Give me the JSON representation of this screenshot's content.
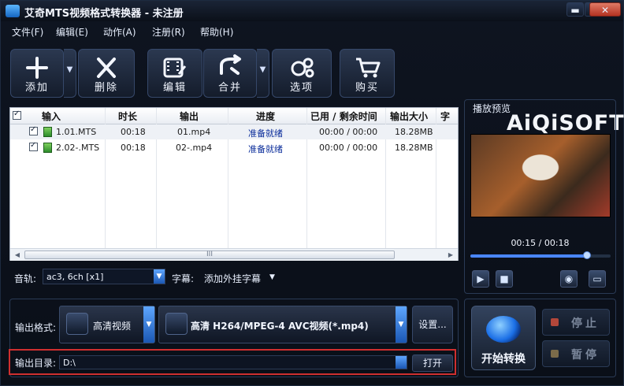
{
  "window": {
    "title": "艾奇MTS视频格式转换器 - 未注册",
    "min": "▬",
    "max": "▢",
    "close": "✕"
  },
  "menu": [
    {
      "label": "文件(F)"
    },
    {
      "label": "编辑(E)"
    },
    {
      "label": "动作(A)"
    },
    {
      "label": "注册(R)"
    },
    {
      "label": "帮助(H)"
    }
  ],
  "toolbar": {
    "add": "添加",
    "delete": "删除",
    "edit": "编辑",
    "merge": "合并",
    "options": "选项",
    "buy": "购买",
    "dropdown": "▼"
  },
  "brand": {
    "logo_text": "AiQiSOFT"
  },
  "table": {
    "headers": [
      "输入",
      "时长",
      "输出",
      "进度",
      "已用 / 剩余时间",
      "输出大小",
      "字幕"
    ],
    "rows": [
      {
        "input": "1.01.MTS",
        "duration": "00:18",
        "output": "01.mp4",
        "progress": "准备就绪",
        "time": "00:00 / 00:00",
        "size": "18.28MB"
      },
      {
        "input": "2.02-.MTS",
        "duration": "00:18",
        "output": "02-.mp4",
        "progress": "准备就绪",
        "time": "00:00 / 00:00",
        "size": "18.28MB"
      }
    ],
    "scroll_grip": "III"
  },
  "audio": {
    "label": "音轨:",
    "value": "ac3, 6ch [x1]"
  },
  "subtitle": {
    "label": "字幕:",
    "value": "添加外挂字幕",
    "arrow": "▼"
  },
  "preview": {
    "title": "播放预览",
    "time": "00:15 / 00:18",
    "progress": 0.83,
    "buttons": {
      "play": "▶",
      "stop": "■",
      "snapshot": "◉",
      "folder": "▭"
    }
  },
  "output": {
    "format_label": "输出格式:",
    "format_category": "高清视频",
    "format_value": "高清 H264/MPEG-4 AVC视频(*.mp4)",
    "settings_button": "设置...",
    "dir_label": "输出目录:",
    "dir_value": "D:\\",
    "open_button": "打开"
  },
  "controls": {
    "start": "开始转换",
    "stop": "停止",
    "pause": "暂停"
  },
  "colors": {
    "accent": "#1b57b3",
    "highlight_border": "#cf2f2f",
    "status_text": "#0a2c9a"
  }
}
